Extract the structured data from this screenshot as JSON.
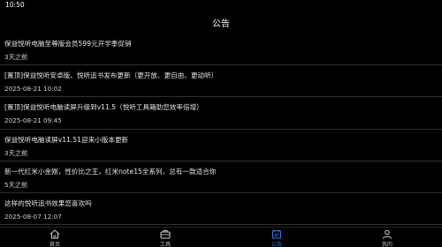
{
  "status_bar": {
    "time": "10:50"
  },
  "header": {
    "title": "公告"
  },
  "notices": [
    {
      "title": "保益悦听电脑至尊版会员599元开学季促销",
      "date": "3天之前"
    },
    {
      "title": "[置顶]保益悦听安卓版、悦听追书发布更新（更开放、更自由、更动听）",
      "date": "2025-08-21 10:02"
    },
    {
      "title": "[置顶]保益悦听电脑读屏升级到v11.5（悦听工具箱助您效率倍增）",
      "date": "2025-08-21 09:45"
    },
    {
      "title": "保益悦听电脑读屏v11.51迎来小版本更新",
      "date": "3天之前"
    },
    {
      "title": "新一代红米小金刚，性价比之王，红米note15全系列，总有一款适合你",
      "date": "5天之前"
    },
    {
      "title": "这样的悦听追书效果您喜欢吗",
      "date": "2025-08-07 12:07"
    }
  ],
  "tabs": [
    {
      "label": "首页",
      "icon": "home-icon"
    },
    {
      "label": "工具",
      "icon": "toolbox-icon"
    },
    {
      "label": "公告",
      "icon": "announcement-icon",
      "active": true
    },
    {
      "label": "我的",
      "icon": "profile-icon"
    }
  ],
  "colors": {
    "background": "#000000",
    "active_tab": "#2f7df6",
    "divider": "#2f2f2f"
  }
}
